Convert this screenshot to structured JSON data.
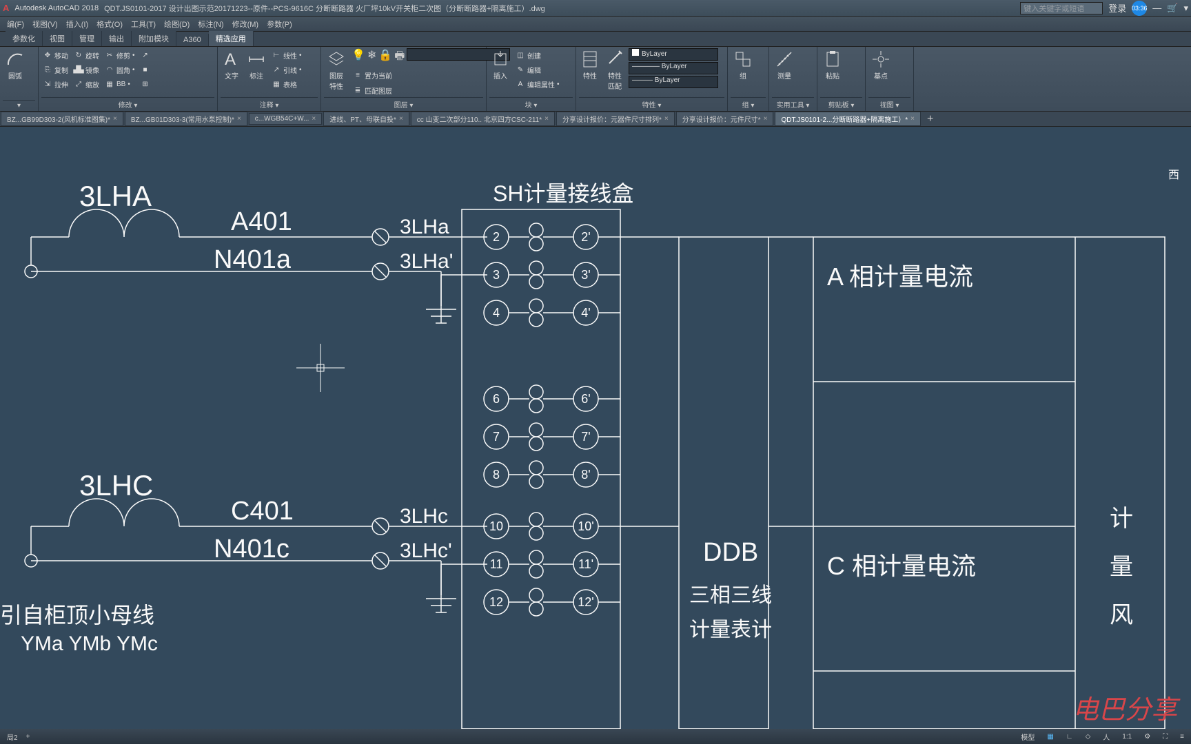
{
  "titlebar": {
    "app": "Autodesk AutoCAD 2018",
    "doc": "QDT.JS0101-2017 设计出图示范20171223--原件--PCS-9616C 分断断路器 火厂坪10kV开关柜二次图（分断断路器+隔离施工）.dwg",
    "search_placeholder": "键入关键字或短语",
    "login": "登录",
    "clock": "03:36"
  },
  "menubar": [
    "编(F)",
    "视图(V)",
    "插入(I)",
    "格式(O)",
    "工具(T)",
    "绘图(D)",
    "标注(N)",
    "修改(M)",
    "参数(P)"
  ],
  "ribbontabs": [
    "参数化",
    "视图",
    "管理",
    "输出",
    "附加模块",
    "A360",
    "精选应用"
  ],
  "ribbon": {
    "modify": {
      "title": "修改 ▾",
      "items": [
        "移动",
        "复制",
        "拉伸"
      ],
      "items2": [
        "旋转",
        "镜像",
        "缩放"
      ],
      "items3": [
        "修剪",
        "圆角",
        "BB"
      ]
    },
    "annotate": {
      "title": "注释 ▾",
      "text": "文字",
      "dim": "标注",
      "leader": "引线",
      "table": "表格",
      "linear": "线性"
    },
    "layers": {
      "title": "图层 ▾",
      "btn": "图层\n特性",
      "make_current": "置为当前",
      "match": "匹配图层"
    },
    "block": {
      "title": "块 ▾",
      "insert": "插入",
      "create": "创建",
      "edit": "编辑",
      "attr": "编辑属性"
    },
    "properties": {
      "title": "特性 ▾",
      "btn": "特性",
      "match": "特性\n匹配",
      "bylayer": "ByLayer"
    },
    "group": {
      "title": "组 ▾",
      "label": "组"
    },
    "utilities": {
      "title": "实用工具 ▾",
      "label": "测量"
    },
    "clipboard": {
      "title": "剪贴板 ▾",
      "label": "粘贴"
    },
    "view": {
      "title": "视图 ▾",
      "label": "基点"
    }
  },
  "filetabs": [
    {
      "name": "BZ...GB99D303-2(风机标准图集)*",
      "active": false
    },
    {
      "name": "BZ...GB01D303-3(常用水泵控制)*",
      "active": false
    },
    {
      "name": "c...WGB54C+W...",
      "active": false
    },
    {
      "name": "进线、PT、母联自投*",
      "active": false
    },
    {
      "name": "cc 山变二次部分110.. 北京四方CSC-211*",
      "active": false
    },
    {
      "name": "分享设计报价：元器件尺寸排列*",
      "active": false
    },
    {
      "name": "分享设计报价：元件尺寸*",
      "active": false
    },
    {
      "name": "QDT.JS0101-2...分断断路器+隔离施工）*",
      "active": true
    }
  ],
  "drawing": {
    "labels": {
      "lha": "3LHA",
      "lhc": "3LHC",
      "a401": "A401",
      "n401a": "N401a",
      "c401": "C401",
      "n401c": "N401c",
      "lha_small": "3LHa",
      "lha_prime": "3LHa'",
      "lhc_small": "3LHc",
      "lhc_prime": "3LHc'",
      "sh_box": "SH计量接线盒",
      "ddb": "DDB",
      "three_phase": "三相三线",
      "meter": "计量表计",
      "a_current": "A 相计量电流",
      "c_current": "C 相计量电流",
      "ji": "计",
      "liang": "量",
      "fen": "风",
      "bus_source": "引自柜顶小母线",
      "yma": "YMa YMb YMc"
    },
    "terminals_left": [
      "2",
      "3",
      "4",
      "6",
      "7",
      "8",
      "10",
      "11",
      "12"
    ],
    "terminals_right": [
      "2'",
      "3'",
      "4'",
      "6'",
      "7'",
      "8'",
      "10'",
      "11'",
      "12'"
    ]
  },
  "statusbar": {
    "layout": "局2",
    "plus": "+",
    "model": "模型",
    "scale": "1:1",
    "nav": "西"
  },
  "watermark": "电巴分享"
}
